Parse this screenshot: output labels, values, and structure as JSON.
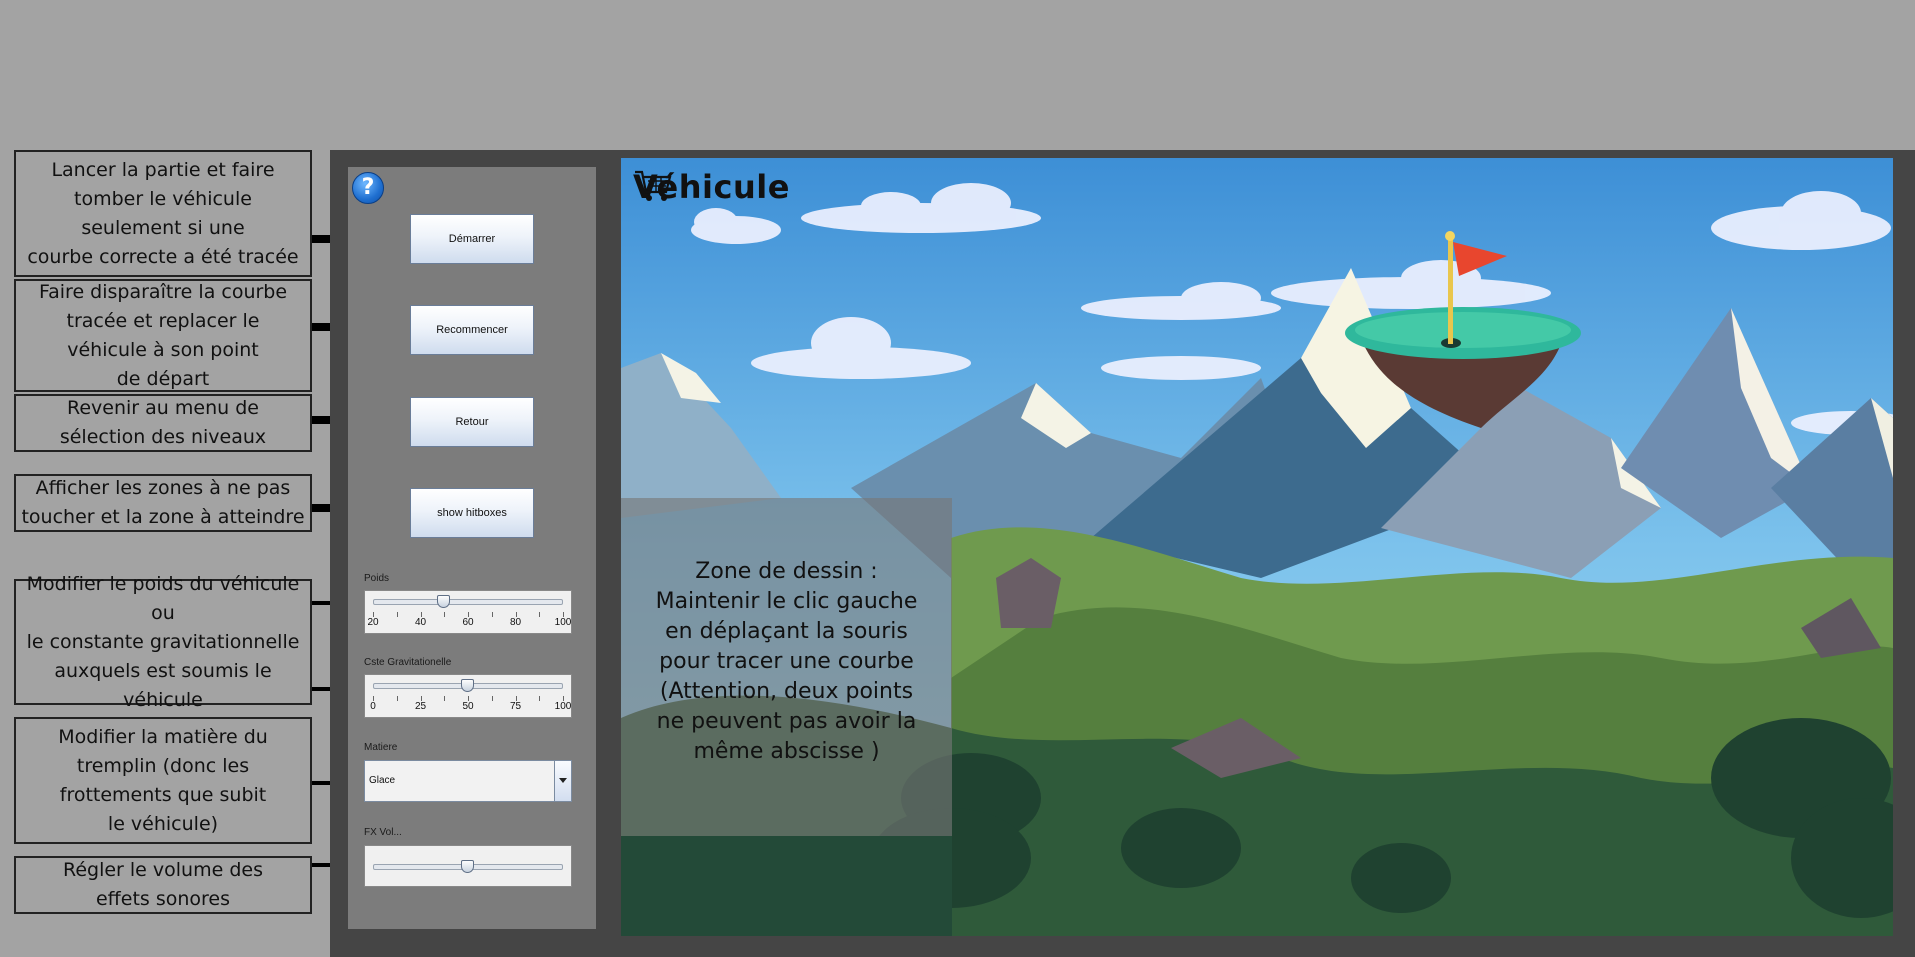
{
  "annotations": {
    "start": "Lancer la partie et faire\ntomber le véhicule\nseulement si une\ncourbe correcte a été tracée",
    "restart": "Faire disparaître la courbe\ntracée et replacer le\nvéhicule à son point\nde départ",
    "back": "Revenir au menu de\nsélection des niveaux",
    "hitboxes": "Afficher les zones à ne pas\ntoucher et la zone à atteindre",
    "sliders": "Modifier le poids du véhicule\nou\nle constante gravitationnelle\nauxquels est soumis le véhicule",
    "material": "Modifier la matière du\ntremplin (donc les\nfrottements que subit\nle véhicule)",
    "volume": "Régler le volume des\neffets sonores"
  },
  "panel": {
    "help_icon": "?",
    "buttons": {
      "start": "Démarrer",
      "restart": "Recommencer",
      "back": "Retour",
      "hitboxes": "show hitboxes"
    },
    "poids": {
      "label": "Poids",
      "value": 50,
      "min": 20,
      "max": 100,
      "ticks": [
        "20",
        "40",
        "60",
        "80",
        "100"
      ]
    },
    "gravite": {
      "label": "Cste Gravitationelle",
      "value": 50,
      "min": 0,
      "max": 100,
      "ticks": [
        "0",
        "25",
        "50",
        "75",
        "100"
      ]
    },
    "matiere": {
      "label": "Matiere",
      "selected": "Glace"
    },
    "fx_volume": {
      "label": "FX Vol...",
      "value_fraction": 0.5
    }
  },
  "game": {
    "title": "Véhicule",
    "icon": "shopping-cart-icon",
    "draw_zone_text": "Zone de dessin :\nMaintenir le clic gauche\nen déplaçant la souris\npour tracer une courbe\n(Attention, deux points\nne peuvent pas avoir la\nmême abscisse )"
  },
  "colors": {
    "background": "#a3a3a3",
    "frame": "#454545",
    "panel": "#7c7c7c",
    "sky": "#4c98d8",
    "flag": "#e8462e"
  }
}
